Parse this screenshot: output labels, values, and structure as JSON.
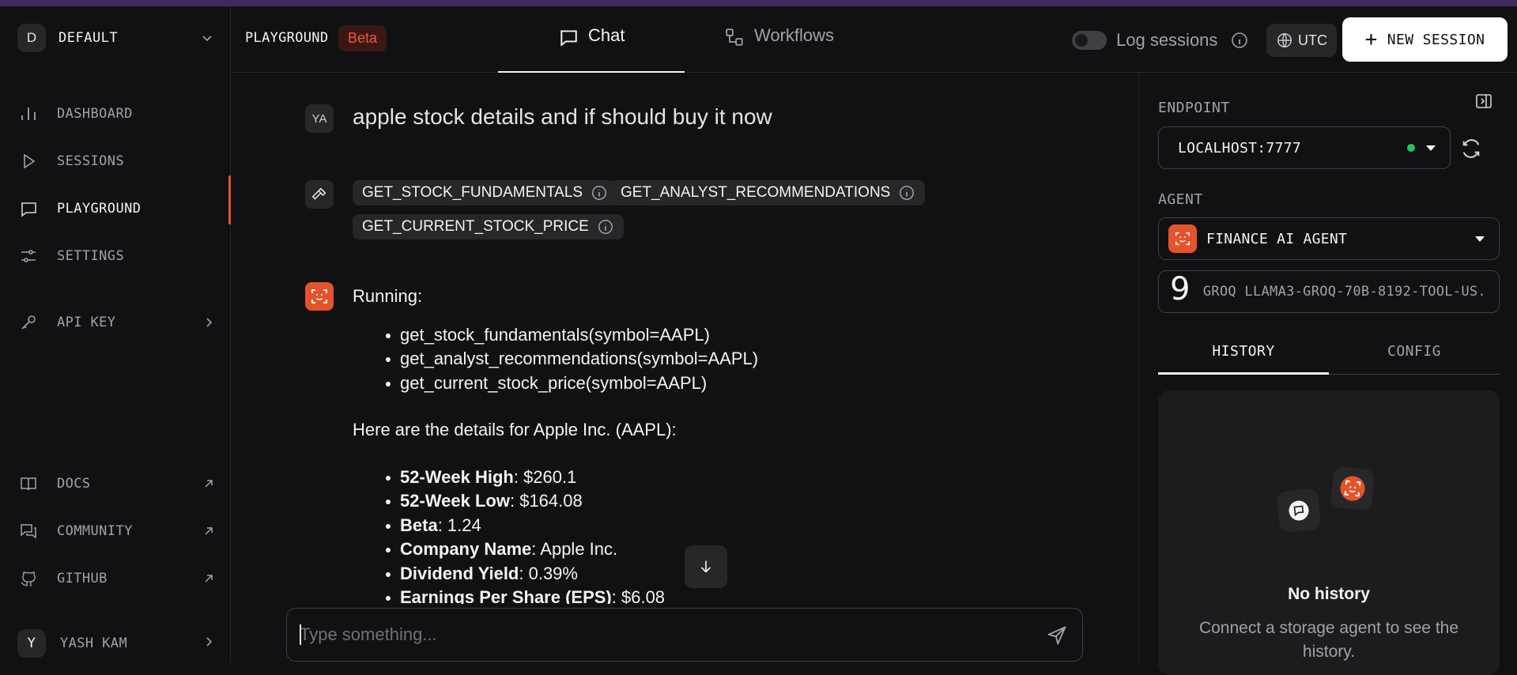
{
  "workspace": {
    "initial": "D",
    "name": "DEFAULT"
  },
  "nav": {
    "dashboard": "DASHBOARD",
    "sessions": "SESSIONS",
    "playground": "PLAYGROUND",
    "settings": "SETTINGS",
    "api_key": "API KEY",
    "docs": "DOCS",
    "community": "COMMUNITY",
    "github": "GITHUB"
  },
  "user": {
    "initial": "Y",
    "name": "YASH KAM"
  },
  "header": {
    "title": "PLAYGROUND",
    "badge": "Beta",
    "tabs": [
      {
        "label": "Chat"
      },
      {
        "label": "Workflows"
      }
    ],
    "log_sessions": "Log sessions",
    "timezone": "UTC",
    "new_session": "NEW SESSION"
  },
  "chat": {
    "user_avatar": "YA",
    "user_message": "apple stock details and if should buy it now",
    "tools": [
      "GET_STOCK_FUNDAMENTALS",
      "GET_ANALYST_RECOMMENDATIONS",
      "GET_CURRENT_STOCK_PRICE"
    ],
    "reply": {
      "running": "Running:",
      "calls": [
        "get_stock_fundamentals(symbol=AAPL)",
        "get_analyst_recommendations(symbol=AAPL)",
        "get_current_stock_price(symbol=AAPL)"
      ],
      "intro": "Here are the details for Apple Inc. (AAPL):",
      "details": [
        {
          "label": "52-Week High",
          "value": ": $260.1"
        },
        {
          "label": "52-Week Low",
          "value": ": $164.08"
        },
        {
          "label": "Beta",
          "value": ": 1.24"
        },
        {
          "label": "Company Name",
          "value": ": Apple Inc."
        },
        {
          "label": "Dividend Yield",
          "value": ": 0.39%"
        },
        {
          "label": "Earnings Per Share (EPS)",
          "value": ": $6.08"
        }
      ]
    },
    "input_placeholder": "Type something..."
  },
  "right_panel": {
    "endpoint_label": "ENDPOINT",
    "endpoint_value": "LOCALHOST:7777",
    "agent_label": "AGENT",
    "agent_value": "FINANCE AI AGENT",
    "model_glyph": "9",
    "model_value": "GROQ LLAMA3-GROQ-70B-8192-TOOL-US...",
    "tabs": [
      {
        "label": "HISTORY"
      },
      {
        "label": "CONFIG"
      }
    ],
    "history_empty_title": "No history",
    "history_empty_sub": "Connect a storage agent to see the history."
  },
  "colors": {
    "accent": "#e4532c",
    "status_ok": "#22c55e",
    "bg": "#111113"
  }
}
